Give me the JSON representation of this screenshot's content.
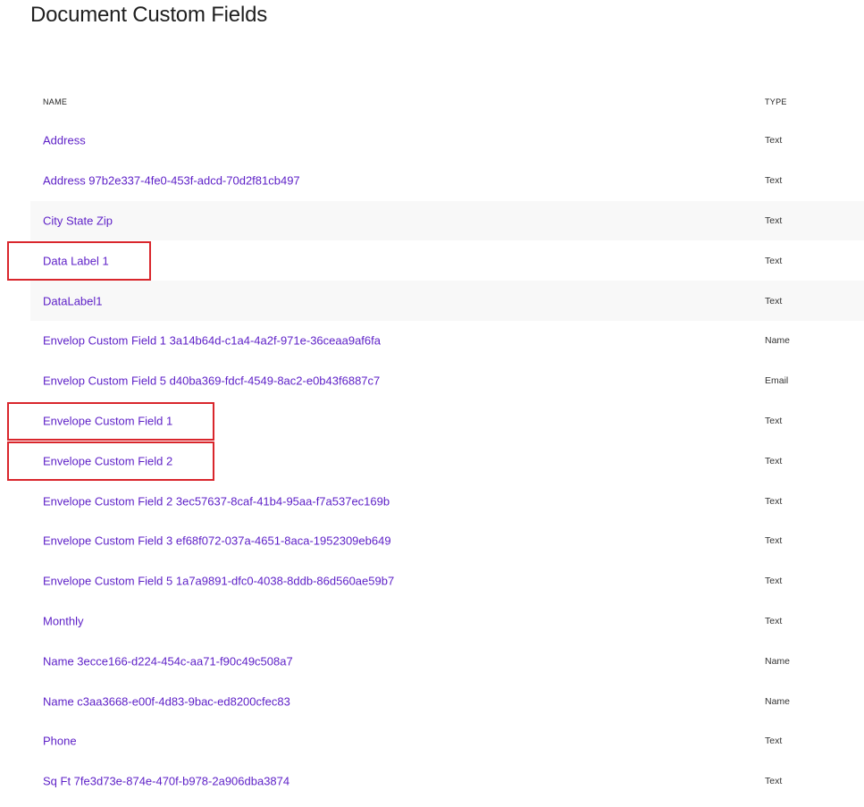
{
  "page": {
    "title": "Document Custom Fields"
  },
  "table": {
    "columns": {
      "name": "NAME",
      "type": "TYPE"
    },
    "rows": [
      {
        "name": "Address",
        "type": "Text",
        "shaded": false,
        "highlighted": false
      },
      {
        "name": "Address 97b2e337-4fe0-453f-adcd-70d2f81cb497",
        "type": "Text",
        "shaded": false,
        "highlighted": false
      },
      {
        "name": "City State Zip",
        "type": "Text",
        "shaded": true,
        "highlighted": false
      },
      {
        "name": "Data Label 1",
        "type": "Text",
        "shaded": false,
        "highlighted": true
      },
      {
        "name": "DataLabel1",
        "type": "Text",
        "shaded": true,
        "highlighted": false
      },
      {
        "name": "Envelop Custom Field 1 3a14b64d-c1a4-4a2f-971e-36ceaa9af6fa",
        "type": "Name",
        "shaded": false,
        "highlighted": false
      },
      {
        "name": "Envelop Custom Field 5 d40ba369-fdcf-4549-8ac2-e0b43f6887c7",
        "type": "Email",
        "shaded": false,
        "highlighted": false
      },
      {
        "name": "Envelope Custom Field 1",
        "type": "Text",
        "shaded": false,
        "highlighted": true
      },
      {
        "name": "Envelope Custom Field 2",
        "type": "Text",
        "shaded": false,
        "highlighted": true
      },
      {
        "name": "Envelope Custom Field 2 3ec57637-8caf-41b4-95aa-f7a537ec169b",
        "type": "Text",
        "shaded": false,
        "highlighted": false
      },
      {
        "name": "Envelope Custom Field 3 ef68f072-037a-4651-8aca-1952309eb649",
        "type": "Text",
        "shaded": false,
        "highlighted": false
      },
      {
        "name": "Envelope Custom Field 5 1a7a9891-dfc0-4038-8ddb-86d560ae59b7",
        "type": "Text",
        "shaded": false,
        "highlighted": false
      },
      {
        "name": "Monthly",
        "type": "Text",
        "shaded": false,
        "highlighted": false
      },
      {
        "name": "Name 3ecce166-d224-454c-aa71-f90c49c508a7",
        "type": "Name",
        "shaded": false,
        "highlighted": false
      },
      {
        "name": "Name c3aa3668-e00f-4d83-9bac-ed8200cfec83",
        "type": "Name",
        "shaded": false,
        "highlighted": false
      },
      {
        "name": "Phone",
        "type": "Text",
        "shaded": false,
        "highlighted": false
      },
      {
        "name": "Sq Ft 7fe3d73e-874e-470f-b978-2a906dba3874",
        "type": "Text",
        "shaded": false,
        "highlighted": false
      }
    ]
  },
  "colors": {
    "link": "#5d1fc7",
    "highlight_border": "#d9262c",
    "shaded_row": "#f8f8f8"
  }
}
